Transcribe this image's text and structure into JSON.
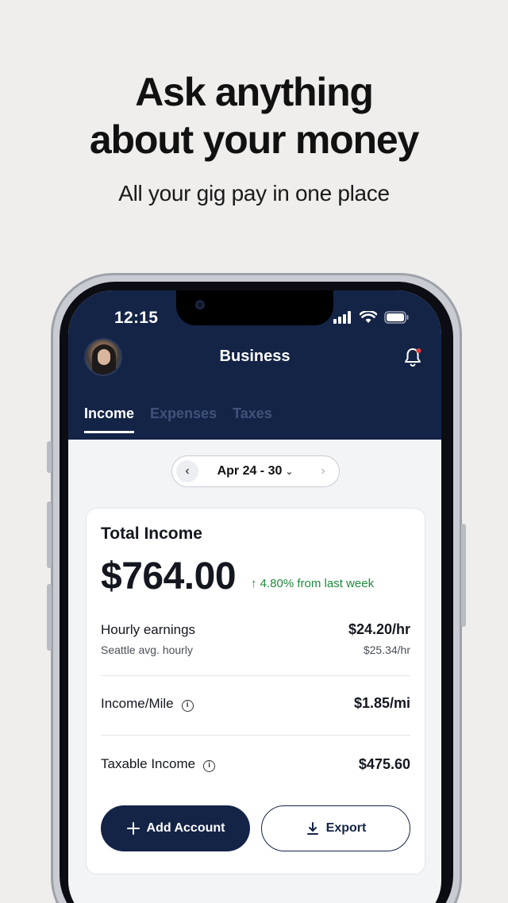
{
  "promo": {
    "title_line1": "Ask anything",
    "title_line2": "about your money",
    "subtitle": "All your gig pay in one place"
  },
  "status_bar": {
    "time": "12:15",
    "icons": [
      "signal-icon",
      "wifi-icon",
      "battery-icon"
    ]
  },
  "header": {
    "title": "Business",
    "notification_dot_color": "#e53935"
  },
  "tabs": [
    {
      "label": "Income",
      "active": true
    },
    {
      "label": "Expenses",
      "active": false
    },
    {
      "label": "Taxes",
      "active": false
    }
  ],
  "period": {
    "label": "Apr 24 - 30",
    "prev_icon": "chevron-left-icon",
    "next_icon": "chevron-right-icon",
    "dropdown_icon": "chevron-down-icon"
  },
  "summary": {
    "title": "Total Income",
    "amount": "$764.00",
    "delta": "4.80% from last week",
    "delta_color": "#1e8a3c"
  },
  "rows": {
    "hourly": {
      "label": "Hourly earnings",
      "value": "$24.20/hr",
      "sub_label": "Seattle avg. hourly",
      "sub_value": "$25.34/hr"
    },
    "mile": {
      "label": "Income/Mile",
      "value": "$1.85/mi"
    },
    "taxable": {
      "label": "Taxable Income",
      "value": "$475.60"
    }
  },
  "actions": {
    "add_account": "Add Account",
    "export": "Export"
  },
  "colors": {
    "brand_navy": "#142447",
    "background": "#efeeec"
  }
}
